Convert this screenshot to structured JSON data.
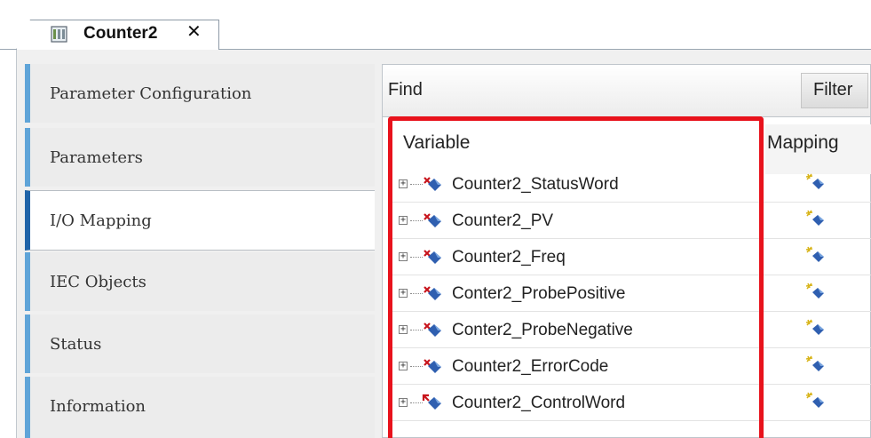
{
  "tab": {
    "title": "Counter2",
    "close_glyph": "✕",
    "icon": "device-module-icon"
  },
  "nav": {
    "items": [
      {
        "label": "Parameter Configuration",
        "active": false
      },
      {
        "label": "Parameters",
        "active": false
      },
      {
        "label": "I/O Mapping",
        "active": true
      },
      {
        "label": "IEC Objects",
        "active": false
      },
      {
        "label": "Status",
        "active": false
      },
      {
        "label": "Information",
        "active": false
      }
    ]
  },
  "toolbar": {
    "find_label": "Find",
    "filter_label": "Filter"
  },
  "table": {
    "columns": [
      "Variable",
      "Mapping"
    ],
    "rows": [
      {
        "variable": "Counter2_StatusWord",
        "direction": "input"
      },
      {
        "variable": "Counter2_PV",
        "direction": "input"
      },
      {
        "variable": "Counter2_Freq",
        "direction": "input"
      },
      {
        "variable": "Conter2_ProbePositive",
        "direction": "input"
      },
      {
        "variable": "Conter2_ProbeNegative",
        "direction": "input"
      },
      {
        "variable": "Counter2_ErrorCode",
        "direction": "input"
      },
      {
        "variable": "Counter2_ControlWord",
        "direction": "output"
      }
    ],
    "mapping_icon": "create-new-variable-icon"
  },
  "colors": {
    "highlight": "#e8121c",
    "nav_accent": "#5fa4d8",
    "nav_active_accent": "#1f63a8"
  }
}
